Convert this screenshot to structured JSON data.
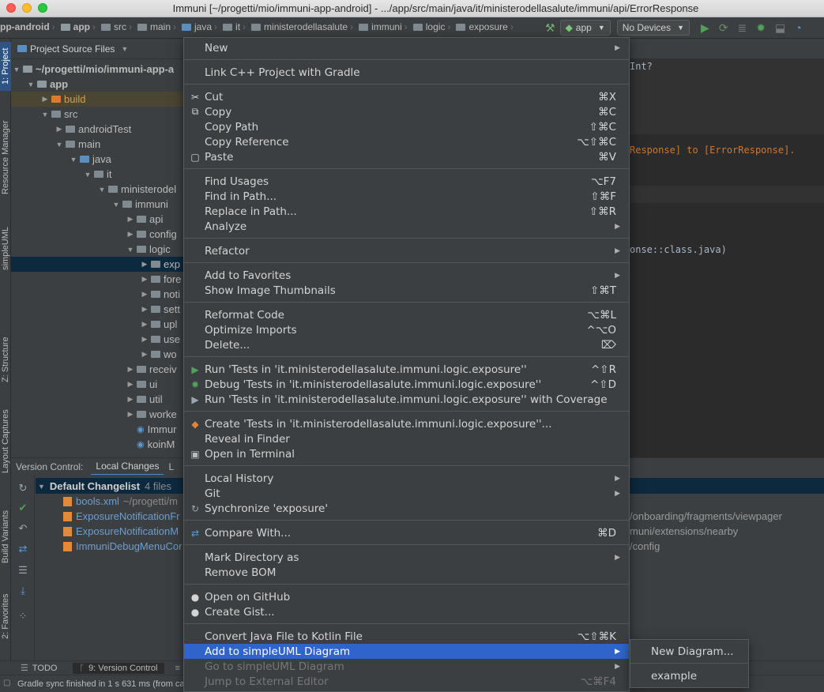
{
  "window": {
    "title": "Immuni [~/progetti/mio/immuni-app-android] - .../app/src/main/java/it/ministerodellasalute/immuni/api/ErrorResponse"
  },
  "navbar": {
    "crumbs": [
      "pp-android",
      "app",
      "src",
      "main",
      "java",
      "it",
      "ministerodellasalute",
      "immuni",
      "logic",
      "exposure"
    ],
    "run_config": "app",
    "device": "No Devices"
  },
  "left_strip": {
    "tabs": [
      "1: Project",
      "Resource Manager",
      "simpleUML",
      "Z: Structure",
      "Layout Captures",
      "Build Variants",
      "2: Favorites"
    ]
  },
  "project_panel": {
    "view_selector": "Project Source Files",
    "tree": [
      {
        "label": "~/progetti/mio/immuni-app-a",
        "arrow": "▼",
        "icon": "module",
        "bold": true
      },
      {
        "label": "app",
        "arrow": "▼",
        "icon": "module",
        "bold": true
      },
      {
        "label": "build",
        "arrow": "▶",
        "icon": "orange",
        "color": "#d0a24e"
      },
      {
        "label": "src",
        "arrow": "▼",
        "icon": "grey"
      },
      {
        "label": "androidTest",
        "arrow": "▶",
        "icon": "grey"
      },
      {
        "label": "main",
        "arrow": "▼",
        "icon": "grey"
      },
      {
        "label": "java",
        "arrow": "▼",
        "icon": "blue"
      },
      {
        "label": "it",
        "arrow": "▼",
        "icon": "grey"
      },
      {
        "label": "ministerodel",
        "arrow": "▼",
        "icon": "grey"
      },
      {
        "label": "immuni",
        "arrow": "▼",
        "icon": "grey"
      },
      {
        "label": "api",
        "arrow": "▶",
        "icon": "grey"
      },
      {
        "label": "config",
        "arrow": "▶",
        "icon": "grey"
      },
      {
        "label": "logic",
        "arrow": "▼",
        "icon": "grey"
      },
      {
        "label": "exp",
        "arrow": "▶",
        "icon": "grey"
      },
      {
        "label": "fore",
        "arrow": "▶",
        "icon": "grey"
      },
      {
        "label": "noti",
        "arrow": "▶",
        "icon": "grey"
      },
      {
        "label": "sett",
        "arrow": "▶",
        "icon": "grey"
      },
      {
        "label": "upl",
        "arrow": "▶",
        "icon": "grey"
      },
      {
        "label": "use",
        "arrow": "▶",
        "icon": "grey"
      },
      {
        "label": "wo",
        "arrow": "▶",
        "icon": "grey"
      },
      {
        "label": "receiv",
        "arrow": "▶",
        "icon": "grey"
      },
      {
        "label": "ui",
        "arrow": "▶",
        "icon": "grey"
      },
      {
        "label": "util",
        "arrow": "▶",
        "icon": "grey"
      },
      {
        "label": "worke",
        "arrow": "▶",
        "icon": "grey"
      },
      {
        "label": "Immur",
        "arrow": "",
        "icon": "kotlin"
      },
      {
        "label": "koinM",
        "arrow": "",
        "icon": "kotlin"
      }
    ]
  },
  "editor": {
    "lines": [
      {
        "text": "Int?",
        "color": "#a9b7c6"
      },
      {
        "text": "Response] to [ErrorResponse].",
        "color": "#cc7832"
      },
      {
        "text": "onse::class.java)",
        "color": "#a9b7c6"
      }
    ]
  },
  "version_control": {
    "tab_title": "Version Control:",
    "tab_local_changes": "Local Changes",
    "tab_partial": "L",
    "changelist": "Default Changelist",
    "file_count": "4 files",
    "files": [
      {
        "name": "bools.xml",
        "path": "~/progetti/m",
        "color": "#6e9ecc"
      },
      {
        "name": "ExposureNotificationFr",
        "path": "",
        "color": "#6e9ecc"
      },
      {
        "name": "ExposureNotificationM",
        "path": "",
        "color": "#6e9ecc"
      },
      {
        "name": "ImmuniDebugMenuCor",
        "path": "",
        "color": "#6e9ecc"
      }
    ],
    "right_paths": [
      "/onboarding/fragments/viewpager",
      "muni/extensions/nearby",
      "/config"
    ]
  },
  "bottom_tools": {
    "todo": "TODO",
    "version_control": "9: Version Control"
  },
  "status": {
    "text": "Gradle sync finished in 1 s 631 ms (from ca"
  },
  "menu": {
    "items": [
      {
        "label": "New",
        "submenu": true
      },
      {
        "sep": true
      },
      {
        "label": "Link C++ Project with Gradle"
      },
      {
        "sep": true
      },
      {
        "label": "Cut",
        "shortcut": "⌘X",
        "icon": "✂",
        "icon_name": "cut-icon"
      },
      {
        "label": "Copy",
        "shortcut": "⌘C",
        "icon": "⧉",
        "icon_name": "copy-icon"
      },
      {
        "label": "Copy Path",
        "shortcut": "⇧⌘C"
      },
      {
        "label": "Copy Reference",
        "shortcut": "⌥⇧⌘C"
      },
      {
        "label": "Paste",
        "shortcut": "⌘V",
        "icon": "▢",
        "icon_name": "paste-icon"
      },
      {
        "sep": true
      },
      {
        "label": "Find Usages",
        "shortcut": "⌥F7"
      },
      {
        "label": "Find in Path...",
        "shortcut": "⇧⌘F"
      },
      {
        "label": "Replace in Path...",
        "shortcut": "⇧⌘R"
      },
      {
        "label": "Analyze",
        "submenu": true
      },
      {
        "sep": true
      },
      {
        "label": "Refactor",
        "submenu": true
      },
      {
        "sep": true
      },
      {
        "label": "Add to Favorites",
        "submenu": true
      },
      {
        "label": "Show Image Thumbnails",
        "shortcut": "⇧⌘T"
      },
      {
        "sep": true
      },
      {
        "label": "Reformat Code",
        "shortcut": "⌥⌘L"
      },
      {
        "label": "Optimize Imports",
        "shortcut": "^⌥O"
      },
      {
        "label": "Delete...",
        "shortcut": "⌦"
      },
      {
        "sep": true
      },
      {
        "label": "Run 'Tests in 'it.ministerodellasalute.immuni.logic.exposure''",
        "shortcut": "^⇧R",
        "icon": "▶",
        "icon_name": "run-icon",
        "icon_color": "#4fa25a"
      },
      {
        "label": "Debug 'Tests in 'it.ministerodellasalute.immuni.logic.exposure''",
        "shortcut": "^⇧D",
        "icon": "✹",
        "icon_name": "debug-icon",
        "icon_color": "#4fa25a"
      },
      {
        "label": "Run 'Tests in 'it.ministerodellasalute.immuni.logic.exposure'' with Coverage",
        "icon": "▶",
        "icon_name": "coverage-icon",
        "icon_color": "#9aa7b0"
      },
      {
        "sep": true
      },
      {
        "label": "Create 'Tests in 'it.ministerodellasalute.immuni.logic.exposure''...",
        "icon": "◆",
        "icon_name": "create-test-icon",
        "icon_color": "#e0853a"
      },
      {
        "label": "Reveal in Finder"
      },
      {
        "label": "Open in Terminal",
        "icon": "▣",
        "icon_name": "terminal-icon",
        "icon_color": "#bbbbbb"
      },
      {
        "sep": true
      },
      {
        "label": "Local History",
        "submenu": true
      },
      {
        "label": "Git",
        "submenu": true
      },
      {
        "label": "Synchronize 'exposure'",
        "icon": "↻",
        "icon_name": "sync-icon",
        "icon_color": "#9aa7b0"
      },
      {
        "sep": true
      },
      {
        "label": "Compare With...",
        "shortcut": "⌘D",
        "icon": "⇄",
        "icon_name": "compare-icon",
        "icon_color": "#5b9bd5"
      },
      {
        "sep": true
      },
      {
        "label": "Mark Directory as",
        "submenu": true
      },
      {
        "label": "Remove BOM"
      },
      {
        "sep": true
      },
      {
        "label": "Open on GitHub",
        "icon": "●",
        "icon_name": "github-icon",
        "icon_color": "#d4d4d4"
      },
      {
        "label": "Create Gist...",
        "icon": "●",
        "icon_name": "github-icon",
        "icon_color": "#d4d4d4"
      },
      {
        "sep": true
      },
      {
        "label": "Convert Java File to Kotlin File",
        "shortcut": "⌥⇧⌘K"
      },
      {
        "label": "Add to simpleUML Diagram",
        "submenu": true,
        "active": true
      },
      {
        "label": "Go to simpleUML Diagram",
        "submenu": true,
        "disabled": true
      },
      {
        "label": "Jump to External Editor",
        "shortcut": "⌥⌘F4",
        "disabled": true
      }
    ]
  },
  "submenu": {
    "items": [
      "New Diagram...",
      "example"
    ]
  },
  "colors": {
    "accent": "#2f65ca",
    "background": "#2b2b2b",
    "panel": "#3c3f41"
  }
}
